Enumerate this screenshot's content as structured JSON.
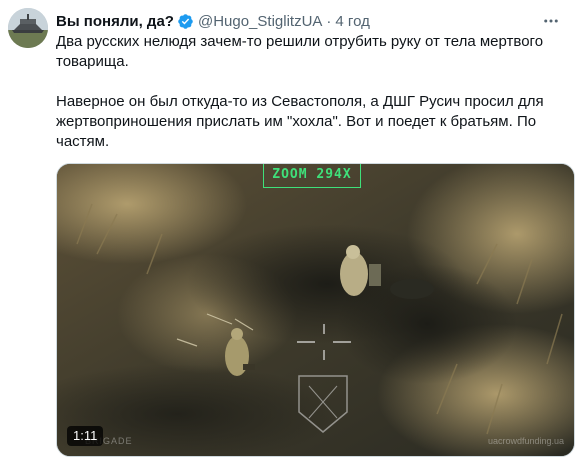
{
  "tweet": {
    "display_name": "Вы поняли, да?",
    "handle": "@Hugo_StiglitzUA",
    "separator": "·",
    "time": "4 год",
    "paragraph_1": "Два русских нелюдя зачем-то решили отрубить руку от тела мертвого товарища.",
    "paragraph_2": "Наверное он был откуда-то из Севастополя, а ДШГ Русич просил для жертвоприношения прислать им \"хохла\". Вот и поедет к братьям. По частям."
  },
  "media": {
    "duration": "1:11",
    "zoom_label": "ZOOM 294X",
    "watermark_left": "BRIGADE",
    "watermark_right": "uacrowdfunding.ua"
  },
  "icons": {
    "verified": "verified-badge-icon",
    "more": "more-horizontal-icon"
  },
  "colors": {
    "text_primary": "#0f1419",
    "text_secondary": "#536471",
    "verified_blue": "#1d9bf0",
    "overlay_green": "#3fe07a"
  }
}
